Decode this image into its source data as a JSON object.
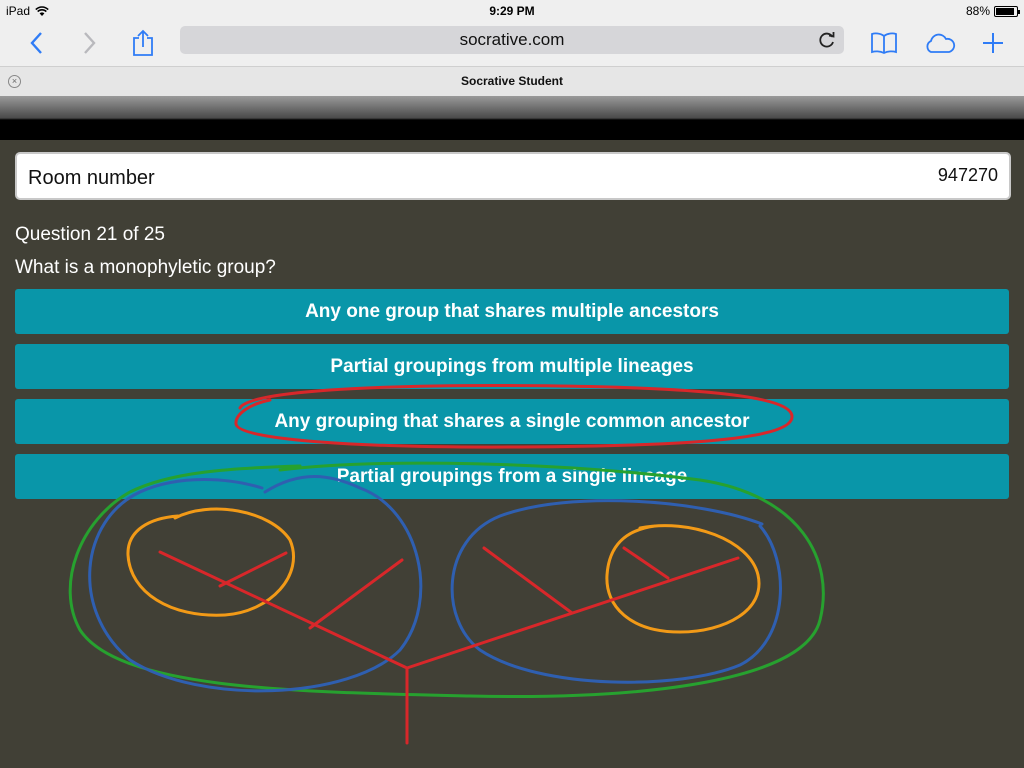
{
  "status_bar": {
    "device": "iPad",
    "time": "9:29 PM",
    "battery_text": "88%",
    "battery_level": 0.88
  },
  "browser": {
    "url": "socrative.com",
    "tab_title": "Socrative Student",
    "accent_color": "#2f7cf6"
  },
  "room": {
    "label": "Room number",
    "value": "947270"
  },
  "question": {
    "number_text": "Question 21 of 25",
    "text": "What is a monophyletic group?",
    "answers": [
      "Any one group that shares multiple ancestors",
      "Partial groupings from multiple lineages",
      "Any grouping that shares a single common ancestor",
      "Partial groupings from a single lineage"
    ],
    "answer_color": "#0996a9"
  },
  "annotation_colors": {
    "red": "#d8272a",
    "green": "#27a12f",
    "blue": "#2f5fb0",
    "orange": "#f29a17"
  }
}
